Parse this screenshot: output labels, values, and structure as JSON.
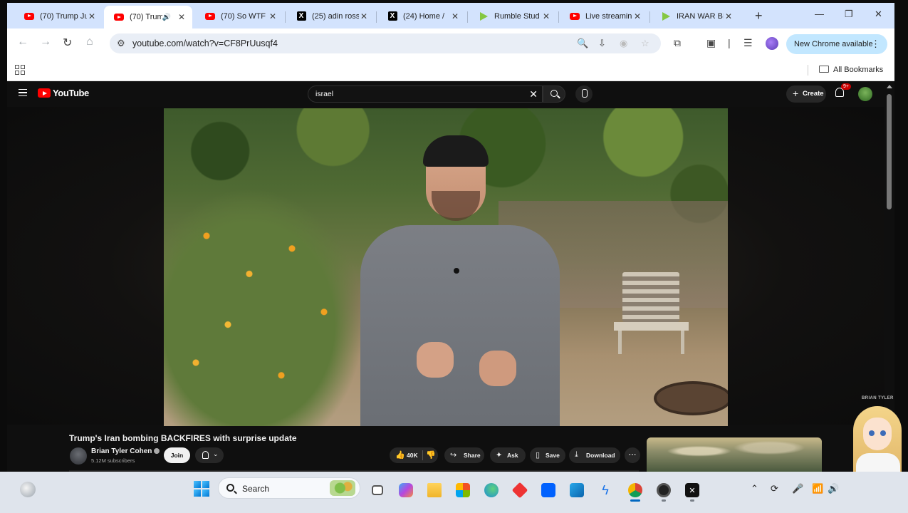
{
  "browser": {
    "tabs": [
      {
        "icon": "youtube",
        "title": "(70) Trump Ju",
        "active": false
      },
      {
        "icon": "youtube",
        "title": "(70) Trum",
        "active": true,
        "audio": true
      },
      {
        "icon": "youtube",
        "title": "(70) So WTF",
        "active": false
      },
      {
        "icon": "x",
        "title": "(25) adin ross",
        "active": false
      },
      {
        "icon": "x",
        "title": "(24) Home /",
        "active": false
      },
      {
        "icon": "rumble",
        "title": "Rumble Stud",
        "active": false
      },
      {
        "icon": "youtube",
        "title": "Live streamin",
        "active": false
      },
      {
        "icon": "rumble",
        "title": "IRAN WAR BE",
        "active": false
      }
    ],
    "url": "youtube.com/watch?v=CF8PrUusqf4",
    "new_chrome_label": "New Chrome available",
    "all_bookmarks_label": "All Bookmarks"
  },
  "youtube": {
    "logo_text": "YouTube",
    "search_query": "israel",
    "create_label": "Create",
    "notification_badge": "9+",
    "video_title": "Trump's Iran bombing BACKFIRES with surprise update",
    "channel_name": "Brian Tyler Cohen",
    "subscribers": "5.12M subscribers",
    "join_label": "Join",
    "like_count": "40K",
    "share_label": "Share",
    "ask_label": "Ask",
    "save_label": "Save",
    "download_label": "Download",
    "watermark": "BRIAN TYLER"
  },
  "taskbar": {
    "search_label": "Search"
  }
}
